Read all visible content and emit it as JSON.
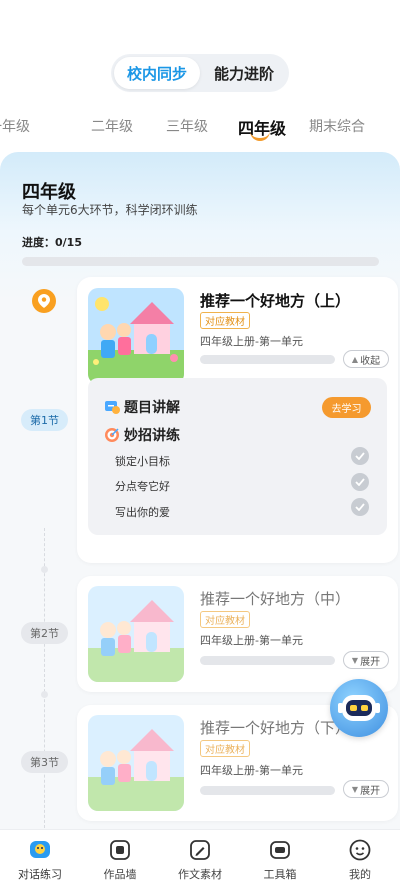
{
  "segment": {
    "active": "校内同步",
    "other": "能力进阶"
  },
  "grades": [
    "一年级",
    "二年级",
    "三年级",
    "四年级",
    "期末综合"
  ],
  "selected_grade_index": 3,
  "panel": {
    "title": "四年级",
    "subtitle": "每个单元6大环节，科学闭环训练",
    "progress_label": "进度：0/15",
    "progress_value": 0
  },
  "sections": [
    {
      "pill": "第1节",
      "title": "推荐一个好地方（上）",
      "tag": "对应教材",
      "unit": "四年级上册-第一单元",
      "toggle": "收起",
      "toggle_glyph": "▲",
      "expanded": true,
      "items": {
        "lecture": "题目讲解",
        "go_label": "去学习",
        "practice": "妙招讲练",
        "tasks": [
          "锁定小目标",
          "分点夸它好",
          "写出你的爱"
        ]
      }
    },
    {
      "pill": "第2节",
      "title": "推荐一个好地方（中）",
      "tag": "对应教材",
      "unit": "四年级上册-第一单元",
      "toggle": "展开",
      "toggle_glyph": "▼",
      "expanded": false
    },
    {
      "pill": "第3节",
      "title": "推荐一个好地方（下）",
      "tag": "对应教材",
      "unit": "四年级上册-第一单元",
      "toggle": "展开",
      "toggle_glyph": "▼",
      "expanded": false
    }
  ],
  "tabs": [
    "对话练习",
    "作品墙",
    "作文素材",
    "工具箱",
    "我的"
  ],
  "colors": {
    "accent": "#1b97e6",
    "orange": "#f59a2e",
    "tag": "#e39218"
  },
  "icons": [
    "location-pin-icon",
    "lecture-icon",
    "target-icon",
    "check-icon",
    "robot-assistant-icon"
  ]
}
